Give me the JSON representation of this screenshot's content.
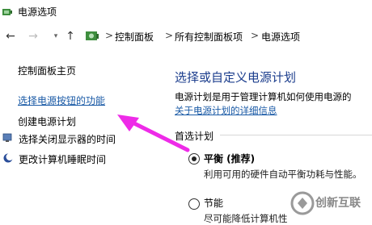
{
  "window": {
    "title": "电源选项"
  },
  "address_bar": {
    "crumbs": [
      "控制面板",
      "所有控制面板项",
      "电源选项"
    ],
    "separator": ">"
  },
  "sidebar": {
    "home_link": "控制面板主页",
    "links": [
      "选择电源按钮的功能",
      "创建电源计划",
      "选择关闭显示器的时间",
      "更改计算机睡眠时间"
    ]
  },
  "main": {
    "heading": "选择或自定义电源计划",
    "description": "电源计划是用于管理计算机如何使用电源的",
    "description_link": "关于电源计划的详细信息",
    "group_label": "首选计划",
    "plans": [
      {
        "name": "平衡 (推荐)",
        "desc": "利用可用的硬件自动平衡功耗与性能。",
        "selected": true
      },
      {
        "name": "节能",
        "desc": "尽可能降低计算机性",
        "selected": false
      }
    ]
  },
  "colors": {
    "link": "#1a5aa6",
    "heading": "#1a3c8c",
    "annotation_arrow": "#ee2be8"
  },
  "watermark": {
    "text": "创新互联"
  }
}
